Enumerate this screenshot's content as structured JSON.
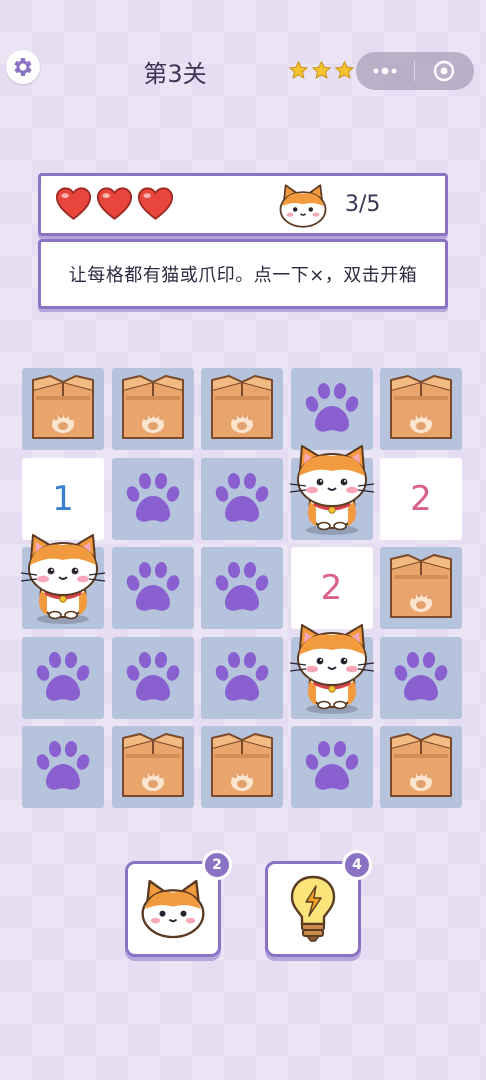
{
  "header": {
    "level_title": "第3关",
    "stars_earned": 3,
    "stars_total": 3
  },
  "status": {
    "hearts_remaining": 3,
    "cat_count_text": "3/5"
  },
  "instruction": "让每格都有猫或爪印。点一下×，双击开箱",
  "board": {
    "rows": 5,
    "cols": 5,
    "cells": [
      [
        "box",
        "box",
        "box",
        "paw",
        "box"
      ],
      [
        "num",
        "paw",
        "paw",
        "cat",
        "num"
      ],
      [
        "cat",
        "paw",
        "paw",
        "num",
        "box"
      ],
      [
        "paw",
        "paw",
        "paw",
        "cat",
        "paw"
      ],
      [
        "paw",
        "box",
        "box",
        "paw",
        "box"
      ]
    ],
    "numbers": {
      "r1c0": "1",
      "r1c4": "2",
      "r2c3": "2"
    }
  },
  "tools": {
    "cat_count": "2",
    "hint_count": "4"
  },
  "colors": {
    "accent": "#8b73c4",
    "paw": "#8a5fd0",
    "cell_bg": "#b5c3dd",
    "number_blue": "#3b7fd0",
    "number_pink": "#d9608a"
  }
}
